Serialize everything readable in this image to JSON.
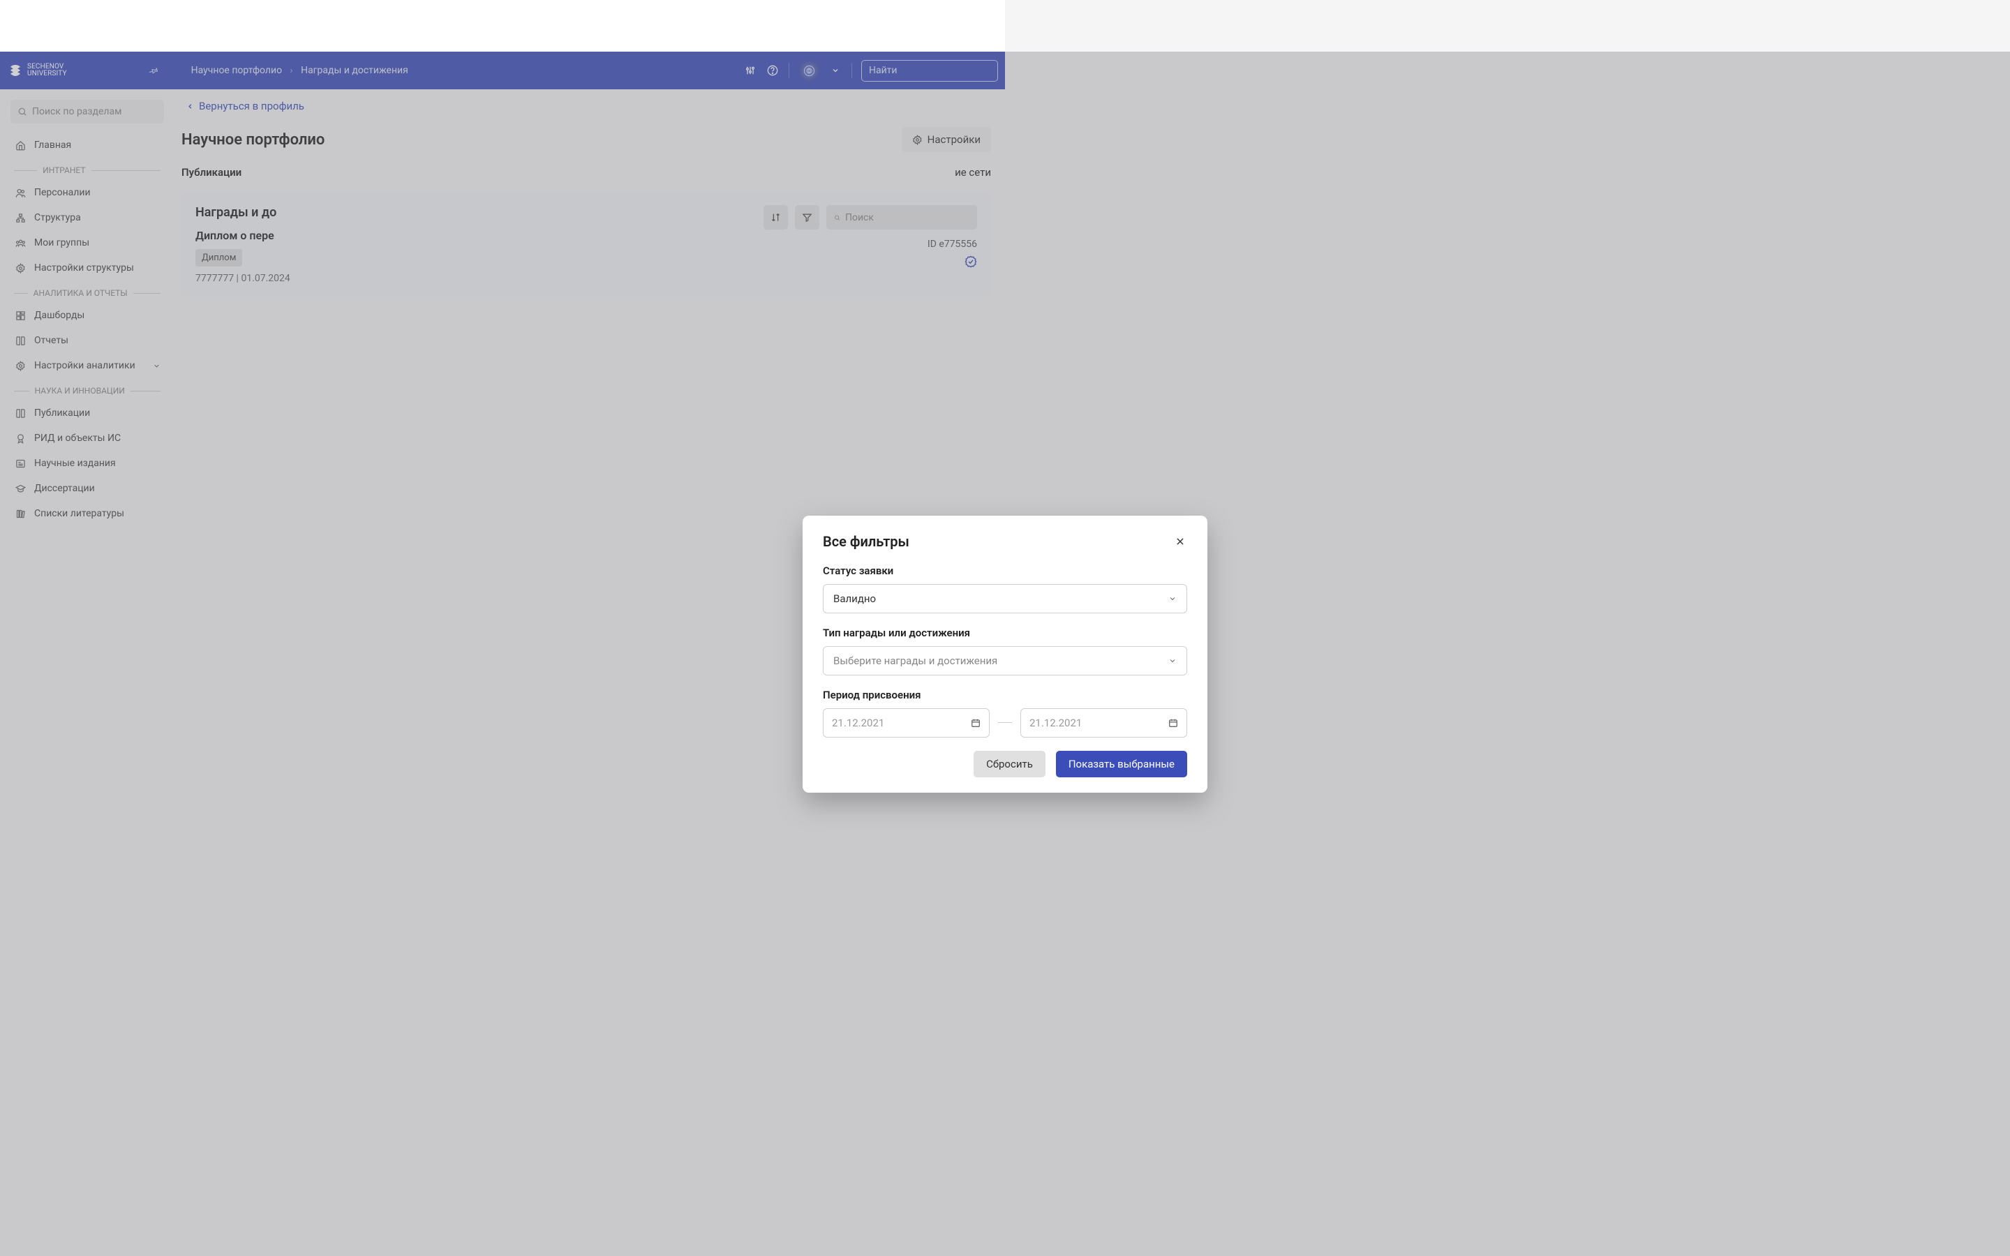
{
  "logo": {
    "line1": "Sechenov",
    "line2": "University"
  },
  "breadcrumb": {
    "item1": "Научное портфолио",
    "item2": "Награды и достижения"
  },
  "header_search_placeholder": "Найти",
  "sidebar": {
    "search_placeholder": "Поиск по разделам",
    "items": {
      "home": "Главная",
      "personnel": "Персоналии",
      "structure": "Структура",
      "groups": "Мои группы",
      "struct_settings": "Настройки структуры",
      "dashboards": "Дашборды",
      "reports": "Отчеты",
      "analytics_settings": "Настройки аналитики",
      "publications": "Публикации",
      "rid": "РИД и объекты ИС",
      "journals": "Научные издания",
      "dissertations": "Диссертации",
      "biblio": "Списки литературы"
    },
    "groups": {
      "intranet": "ИНТРАНЕТ",
      "analytics": "АНАЛИТИКА И ОТЧЕТЫ",
      "science": "НАУКА И ИННОВАЦИИ"
    }
  },
  "page": {
    "back": "Вернуться в профиль",
    "title": "Научное портфолио",
    "settings": "Настройки",
    "tabs": {
      "publications": "Публикации",
      "networks": "ие сети"
    },
    "section_title": "Награды и до",
    "search_placeholder": "Поиск",
    "record": {
      "title": "Диплом о пере",
      "badge": "Диплом",
      "number": "7777777",
      "date": "01.07.2024",
      "id_label": "ID e775556"
    }
  },
  "modal": {
    "title": "Все фильтры",
    "status_label": "Статус заявки",
    "status_value": "Валидно",
    "type_label": "Тип награды или достижения",
    "type_placeholder": "Выберите награды и достижения",
    "period_label": "Период присвоения",
    "date_placeholder": "21.12.2021",
    "reset": "Сбросить",
    "apply": "Показать выбранные"
  }
}
